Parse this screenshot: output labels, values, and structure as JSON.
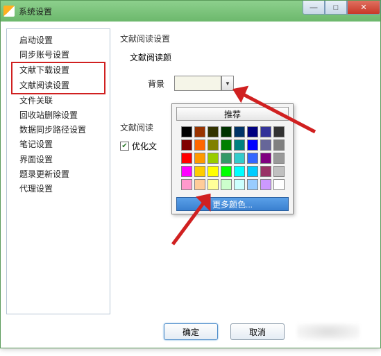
{
  "window": {
    "title": "系统设置",
    "min_tip": "—",
    "max_tip": "□",
    "close_tip": "✕"
  },
  "sidebar": {
    "items": [
      "启动设置",
      "同步账号设置",
      "文献下载设置",
      "文献阅读设置",
      "文件关联",
      "回收站删除设置",
      "数据同步路径设置",
      "笔记设置",
      "界面设置",
      "题录更新设置",
      "代理设置"
    ],
    "highlighted_index_start": 2,
    "highlighted_index_end": 3
  },
  "right": {
    "section": "文献阅读设置",
    "color_label_row": "文献阅读颜",
    "bg_label": "背景",
    "section2": "文献阅读",
    "optimize_label": "优化文"
  },
  "popup": {
    "recommend": "推荐",
    "more": "更多颜色...",
    "swatches": [
      "#000000",
      "#993300",
      "#333300",
      "#003300",
      "#003366",
      "#000080",
      "#333399",
      "#333333",
      "#800000",
      "#ff6600",
      "#808000",
      "#008000",
      "#008080",
      "#0000ff",
      "#666699",
      "#808080",
      "#ff0000",
      "#ff9900",
      "#99cc00",
      "#339966",
      "#33cccc",
      "#3366ff",
      "#800080",
      "#999999",
      "#ff00ff",
      "#ffcc00",
      "#ffff00",
      "#00ff00",
      "#00ffff",
      "#00ccff",
      "#993366",
      "#c0c0c0",
      "#ff99cc",
      "#ffcc99",
      "#ffff99",
      "#ccffcc",
      "#ccffff",
      "#99ccff",
      "#cc99ff",
      "#ffffff"
    ]
  },
  "footer": {
    "ok": "确定",
    "cancel": "取消"
  }
}
